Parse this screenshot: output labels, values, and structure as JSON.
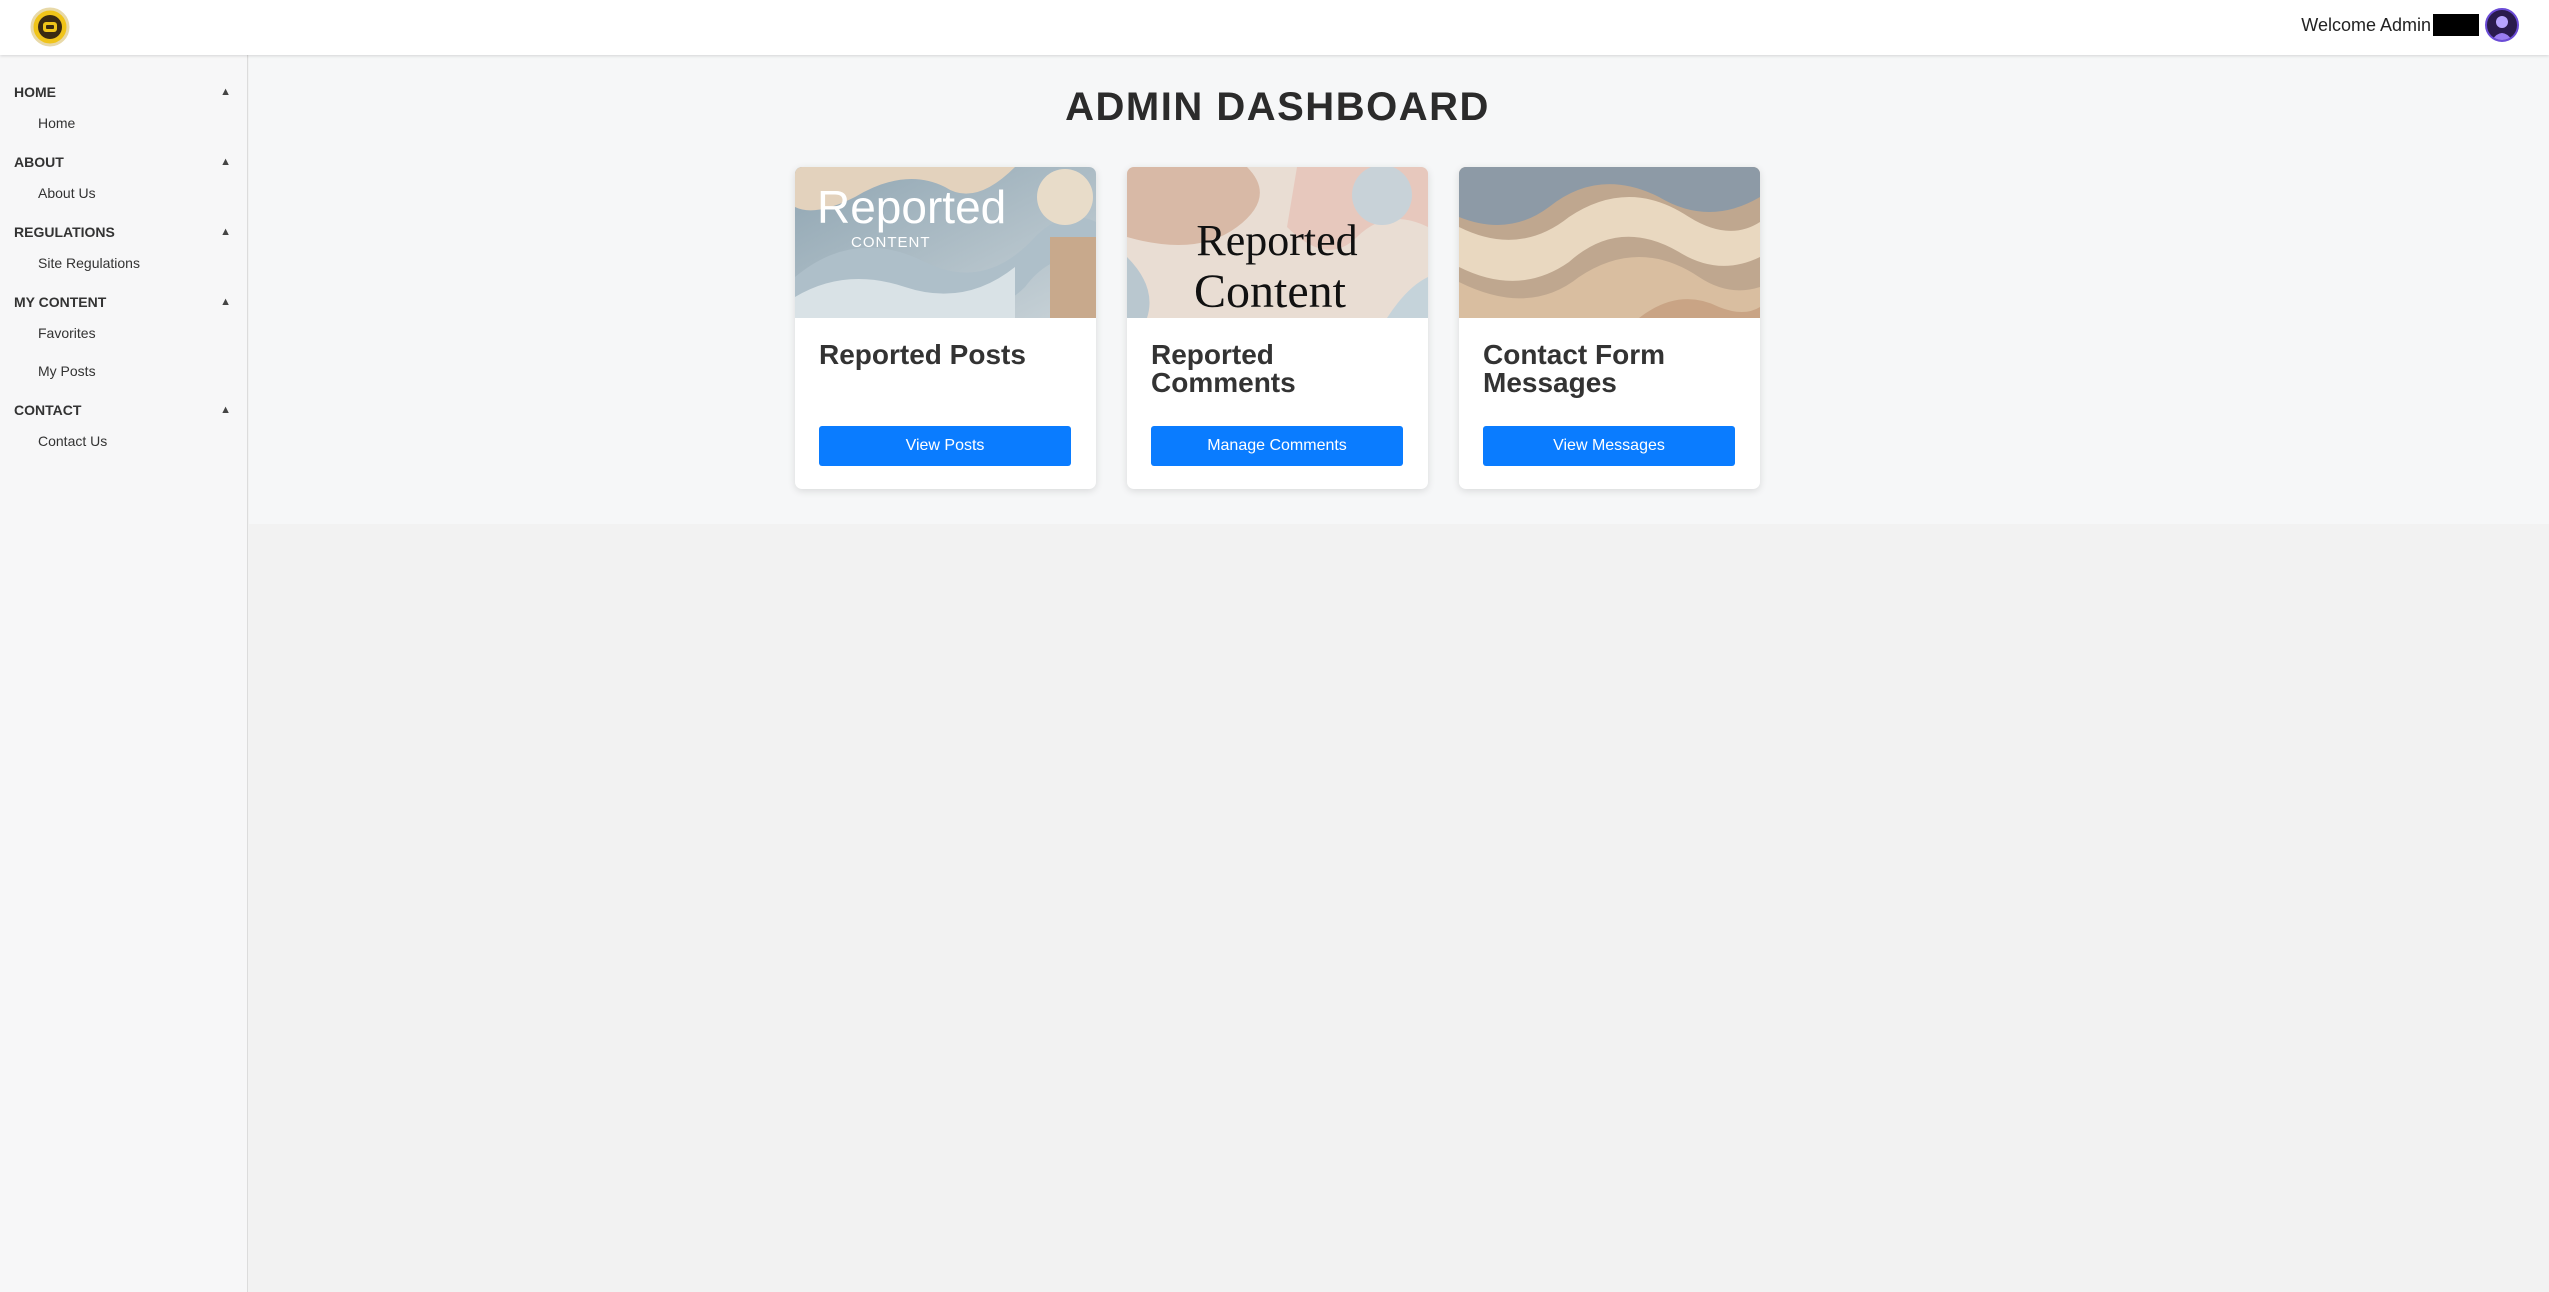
{
  "header": {
    "welcome_text": "Welcome Admin"
  },
  "sidebar": {
    "sections": [
      {
        "title": "HOME",
        "toggle": "▲",
        "items": [
          "Home"
        ]
      },
      {
        "title": "ABOUT",
        "toggle": "▲",
        "items": [
          "About Us"
        ]
      },
      {
        "title": "REGULATIONS",
        "toggle": "▲",
        "items": [
          "Site Regulations"
        ]
      },
      {
        "title": "MY CONTENT",
        "toggle": "▲",
        "items": [
          "Favorites",
          "My Posts"
        ]
      },
      {
        "title": "CONTACT",
        "toggle": "▲",
        "items": [
          "Contact Us"
        ]
      }
    ]
  },
  "main": {
    "page_title": "ADMIN DASHBOARD",
    "cards": [
      {
        "image_text": "Reported",
        "image_subtext": "CONTENT",
        "title": "Reported Posts",
        "button": "View Posts"
      },
      {
        "image_text": "Reported",
        "image_subtext": "Content",
        "title": "Reported Comments",
        "button": "Manage Comments"
      },
      {
        "title": "Contact Form Messages",
        "button": "View Messages"
      }
    ]
  },
  "colors": {
    "accent": "#0a7cff",
    "topbar": "#ffffff",
    "sidebar": "#f7f7f8"
  }
}
